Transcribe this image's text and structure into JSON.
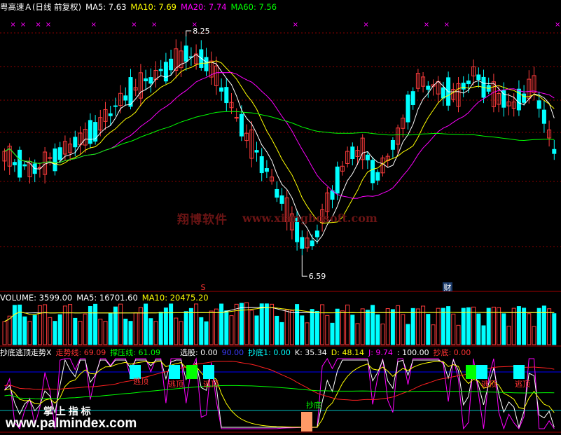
{
  "colors": {
    "up": "#ff3c3c",
    "down": "#00ffff",
    "ma5": "#ffffff",
    "ma10": "#ffff00",
    "ma20": "#ff00ff",
    "ma60": "#00ff00",
    "grid": "#8b0000",
    "vol_ma10": "#ffff00",
    "ind_up_text": "#ff3333",
    "ind_green": "#00ff00",
    "blue": "#0000ff"
  },
  "main": {
    "title": "粤高速Ａ(日线 前复权)",
    "ma5_label": "MA5: 7.63",
    "ma10_label": "MA10: 7.69",
    "ma20_label": "MA20: 7.74",
    "ma60_label": "MA60: 7.56",
    "high_label": "8.25",
    "low_label": "6.59",
    "marker_s": "S",
    "marker_cai": "财",
    "watermark1": "翔博软件",
    "watermark2": "www.xiangbosoft.com"
  },
  "volume": {
    "label": "VOLUME: 3599.00",
    "ma5_label": "MA5: 16701.60",
    "ma10_label": "MA10: 20475.20"
  },
  "indicator": {
    "name": "抄底逃顶走势X",
    "trend_label": "走势线: 69.09",
    "support_label": "撑压线: 61.09",
    "select_label": "选股: 0.00",
    "ninety": "90.00",
    "chaodi1_label": "抄底1: 0.00",
    "k_label": "K: 35.34",
    "d_label": "D: 48.14",
    "j_label": "J: 9.74",
    "hundred_label": ": 100.00",
    "chaodi_label": "抄底: 0.00",
    "tag_taoding": "逃顶",
    "tag_chaodi": "抄底",
    "pm_cn": "掌 上 指 标",
    "pm_url": "www.palmindex.com"
  },
  "chart_data": {
    "type": "candlestick",
    "price_range": [
      6.59,
      8.25
    ],
    "max_price": 8.25,
    "min_price": 6.59,
    "last_values": {
      "MA5": 7.63,
      "MA10": 7.69,
      "MA20": 7.74,
      "MA60": 7.56
    },
    "volume": {
      "last": 3599.0,
      "MA5": 16701.6,
      "MA10": 20475.2
    },
    "indicator_last": {
      "走势线": 69.09,
      "撑压线": 61.09,
      "选股": 0.0,
      "抄底1": 0.0,
      "K": 35.34,
      "D": 48.14,
      "J": 9.74,
      "抄底": 0.0
    }
  }
}
